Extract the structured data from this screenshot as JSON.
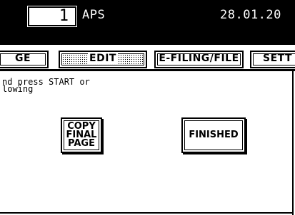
{
  "header": {
    "copy_count": "1",
    "mode": "APS",
    "date": "28.01.20"
  },
  "tabs": [
    {
      "label": "GE",
      "active": false
    },
    {
      "label": "EDIT",
      "active": true
    },
    {
      "label": "E-FILING/FILE",
      "active": false
    },
    {
      "label": "SETT",
      "active": false
    }
  ],
  "message": {
    "line1": "nd press START or",
    "line2": "lowing"
  },
  "buttons": {
    "copy_final_page": [
      "COPY",
      "FINAL",
      "PAGE"
    ],
    "finished": "FINISHED"
  }
}
